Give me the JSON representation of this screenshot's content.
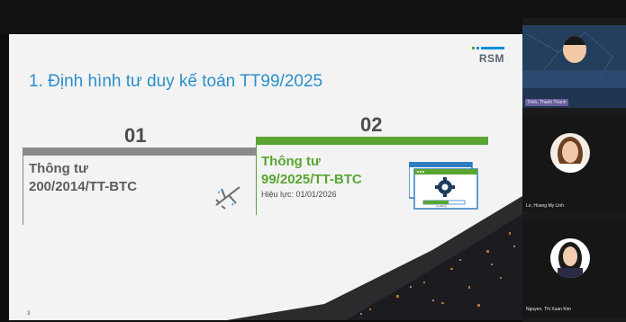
{
  "slide": {
    "title": "1. Định hình tư duy kế toán TT99/2025",
    "logo_text": "RSM",
    "page_number": "3",
    "old_circular": {
      "number": "01",
      "line1": "Thông tư",
      "line2": "200/2014/TT-BTC",
      "icon": "airplane-icon"
    },
    "new_circular": {
      "number": "02",
      "line1": "Thông tư",
      "line2": "99/2025/TT-BTC",
      "effective": "Hiệu lực: 01/01/2026",
      "icon": "software-update-icon",
      "updating_label": "Updating"
    }
  },
  "participants": [
    {
      "name": "Trinh, Thanh Thanh",
      "active": true
    },
    {
      "name": "Le, Hoang My Linh",
      "active": false
    },
    {
      "name": "Nguyen, Thi Xuan Kim",
      "active": false
    }
  ],
  "colors": {
    "title_blue": "#2b8fc9",
    "green": "#5aa532",
    "gray_bar": "#8a8a8a",
    "rsm_blue": "#0a8fd8",
    "rsm_green": "#5aa532"
  }
}
